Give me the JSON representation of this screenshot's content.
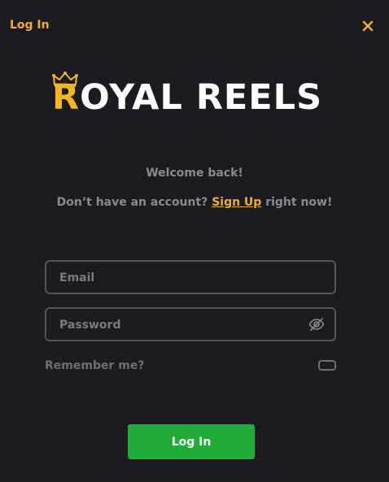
{
  "header": {
    "title": "Log In"
  },
  "brand": {
    "initial": "R",
    "rest": "OYAL REELS",
    "accent_color": "#f2b622"
  },
  "welcome": {
    "text": "Welcome back!"
  },
  "signup": {
    "prefix": "Don’t have an account? ",
    "link_label": "Sign Up",
    "suffix": " right now!"
  },
  "form": {
    "email": {
      "value": "",
      "placeholder": "Email"
    },
    "password": {
      "value": "",
      "placeholder": "Password",
      "toggle_icon": "eye-off-icon"
    },
    "remember_label": "Remember me?",
    "remember_checked": false,
    "submit_label": "Log In"
  },
  "colors": {
    "background": "#1c1c20",
    "accent": "#f4a93b",
    "primary_button": "#21ac3a",
    "muted_text": "#8a8a8e"
  }
}
